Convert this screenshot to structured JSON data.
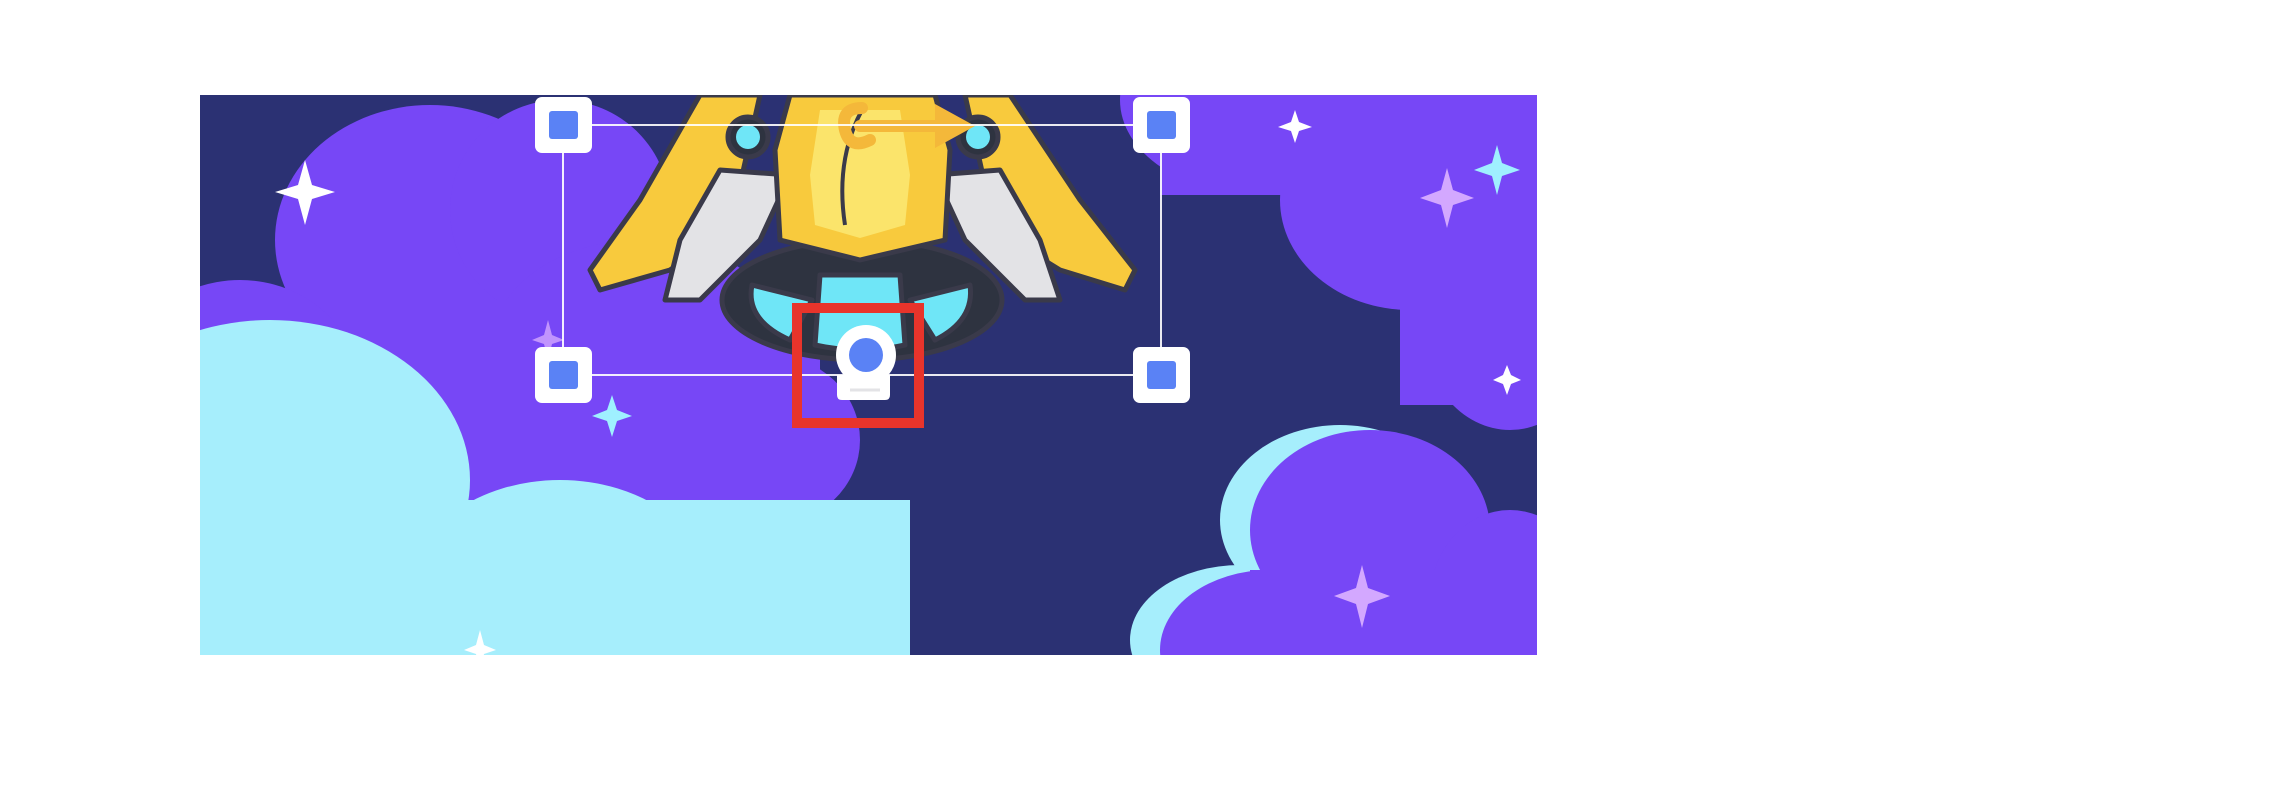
{
  "canvas": {
    "background": "#2b3173",
    "colors": {
      "sky": "#2b3173",
      "purple_cloud": "#7747f6",
      "cyan_cloud": "#a6eefc",
      "star_white": "#ffffff",
      "star_cyan": "#9ff0ff",
      "star_lilac": "#d3a8ff",
      "ship_yellow": "#f8ca3d",
      "ship_light_yellow": "#fbe46b",
      "ship_grey": "#e3e3e6",
      "ship_window": "#6fe6f7",
      "ship_outline": "#3a3a4a"
    }
  },
  "selection": {
    "handle_fill": "#ffffff",
    "handle_inner": "#5a82f5",
    "rotate_arrow_color": "#f4b83a",
    "frame_color": "#ffffff"
  },
  "highlight": {
    "color": "#e8342b"
  },
  "sprite": {
    "icon": "rocket-ship-sprite"
  }
}
